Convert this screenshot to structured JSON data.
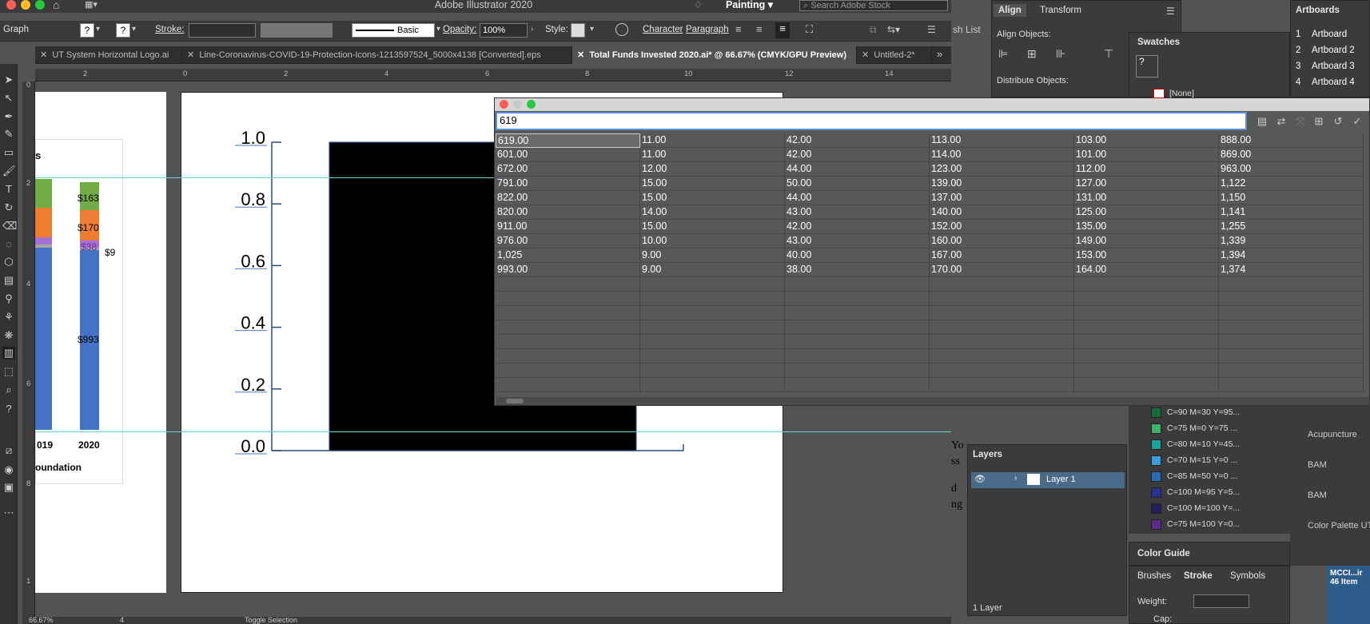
{
  "window": {
    "title": "Adobe Illustrator 2020",
    "workspace": "Painting",
    "search_placeholder": "Search Adobe Stock"
  },
  "control_bar": {
    "mode": "Graph",
    "stroke_label": "Stroke:",
    "brush": "Basic",
    "opacity_label": "Opacity:",
    "opacity_value": "100%",
    "style_label": "Style:",
    "character": "Character",
    "paragraph": "Paragraph"
  },
  "doc_tabs": [
    {
      "label": "UT System Horizontal Logo.ai"
    },
    {
      "label": "Line-Coronavirus-COVID-19-Protection-Icons-1213597524_5000x4138 [Converted].eps"
    },
    {
      "label": "Total Funds Invested 2020.ai* @ 66.67% (CMYK/GPU Preview)"
    },
    {
      "label": "Untitled-2*"
    }
  ],
  "rulers": {
    "h_ticks": [
      "2",
      "0",
      "2",
      "4",
      "6",
      "8",
      "10",
      "12",
      "14"
    ],
    "v_ticks": [
      "0",
      "2",
      "4",
      "6",
      "8",
      "1"
    ]
  },
  "left_artboard": {
    "heading_fragment": "s",
    "labels": [
      "$163",
      "$170",
      "$38",
      "$9",
      "$993"
    ],
    "years": [
      "019",
      "2020"
    ],
    "footer": "oundation"
  },
  "main_chart": {
    "y_ticks": [
      "1.0",
      "0.8",
      "0.6",
      "0.4",
      "0.2",
      "0.0"
    ]
  },
  "chart_data": {
    "type": "bar",
    "categories": [
      ""
    ],
    "values": [
      1.0
    ],
    "ylim": [
      0,
      1.0
    ],
    "y_ticks": [
      0.0,
      0.2,
      0.4,
      0.6,
      0.8,
      1.0
    ],
    "grid": false,
    "colors": [
      "#000000"
    ]
  },
  "graph_data": {
    "input_value": "619",
    "rows": [
      [
        "619.00",
        "11.00",
        "42.00",
        "113.00",
        "103.00",
        "888.00"
      ],
      [
        "601.00",
        "11.00",
        "42.00",
        "114.00",
        "101.00",
        "869.00"
      ],
      [
        "672.00",
        "12.00",
        "44.00",
        "123.00",
        "112.00",
        "963.00"
      ],
      [
        "791.00",
        "15.00",
        "50.00",
        "139.00",
        "127.00",
        "1,122"
      ],
      [
        "822.00",
        "15.00",
        "44.00",
        "137.00",
        "131.00",
        "1,150"
      ],
      [
        "820.00",
        "14.00",
        "43.00",
        "140.00",
        "125.00",
        "1,141"
      ],
      [
        "911.00",
        "15.00",
        "42.00",
        "152.00",
        "135.00",
        "1,255"
      ],
      [
        "976.00",
        "10.00",
        "43.00",
        "160.00",
        "149.00",
        "1,339"
      ],
      [
        "1,025",
        "9.00",
        "40.00",
        "167.00",
        "153.00",
        "1,394"
      ],
      [
        "993.00",
        "9.00",
        "38.00",
        "170.00",
        "164.00",
        "1,374"
      ]
    ]
  },
  "panels": {
    "align": {
      "tab1": "Align",
      "tab2": "Transform",
      "align_objects": "Align Objects:",
      "distribute_objects": "Distribute Objects:"
    },
    "swatches": {
      "title": "Swatches",
      "none": "[None]",
      "items": [
        {
          "label": "C=90 M=30 Y=95...",
          "color": "#1a6b3a"
        },
        {
          "label": "C=75 M=0 Y=75 ...",
          "color": "#3db36b"
        },
        {
          "label": "C=80 M=10 Y=45...",
          "color": "#1aa39a"
        },
        {
          "label": "C=70 M=15 Y=0 ...",
          "color": "#3a9fd8"
        },
        {
          "label": "C=85 M=50 Y=0 ...",
          "color": "#2a6cb8"
        },
        {
          "label": "C=100 M=95 Y=5...",
          "color": "#28318f"
        },
        {
          "label": "C=100 M=100 Y=...",
          "color": "#241f5c"
        },
        {
          "label": "C=75 M=100 Y=0...",
          "color": "#5b2a8a"
        }
      ]
    },
    "artboards": {
      "title": "Artboards",
      "items": [
        {
          "num": "1",
          "name": "Artboard"
        },
        {
          "num": "2",
          "name": "Artboard 2"
        },
        {
          "num": "3",
          "name": "Artboard 3"
        },
        {
          "num": "4",
          "name": "Artboard 4"
        }
      ]
    },
    "libraries": [
      "Acupuncture",
      "BAM",
      "BAM",
      "Color Palette UT"
    ],
    "layers": {
      "title": "Layers",
      "layer_name": "Layer 1",
      "count": "1 Layer"
    },
    "color_guide": {
      "title": "Color Guide"
    },
    "stroke": {
      "tab1": "Brushes",
      "tab2": "Stroke",
      "tab3": "Symbols",
      "weight_label": "Weight:",
      "cap_label": "Cap:"
    },
    "partial_text": {
      "list": "sh List",
      "yo": "Yo",
      "ss": "ss",
      "d": "d",
      "ng": "ng"
    },
    "dock": {
      "label": "MCCI...ir",
      "count": "46 Item"
    }
  },
  "status_bar": {
    "zoom": "66.67%",
    "artboard": "4",
    "toggle": "Toggle Selection"
  }
}
